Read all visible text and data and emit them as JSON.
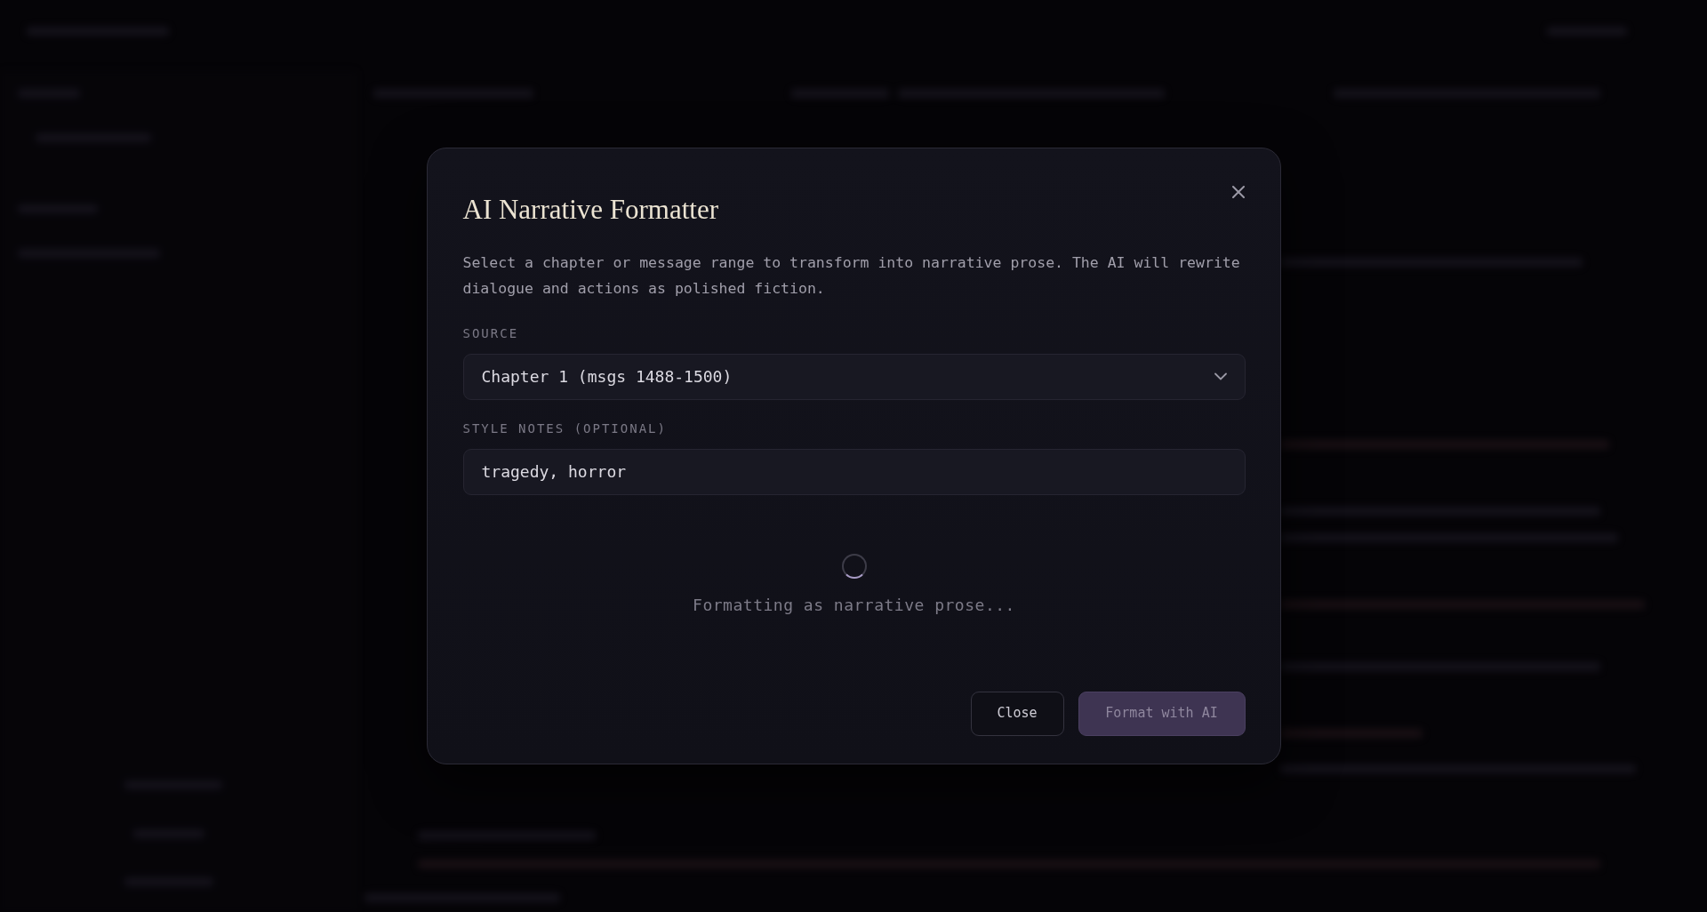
{
  "dialog": {
    "title": "AI Narrative Formatter",
    "description": "Select a chapter or message range to transform into narrative prose. The AI will rewrite dialogue and actions as polished fiction.",
    "fields": [
      {
        "kind": "select",
        "label": "SOURCE",
        "value": "Chapter 1 (msgs 1488-1500)"
      },
      {
        "kind": "text",
        "label": "STYLE NOTES (OPTIONAL)",
        "value": "tragedy, horror"
      }
    ],
    "progress": {
      "loading": true,
      "text": "Formatting as narrative prose..."
    },
    "buttons": [
      {
        "label": "Close",
        "kind": "secondary",
        "disabled": false
      },
      {
        "label": "Format with AI",
        "kind": "primary",
        "disabled": true
      }
    ]
  }
}
